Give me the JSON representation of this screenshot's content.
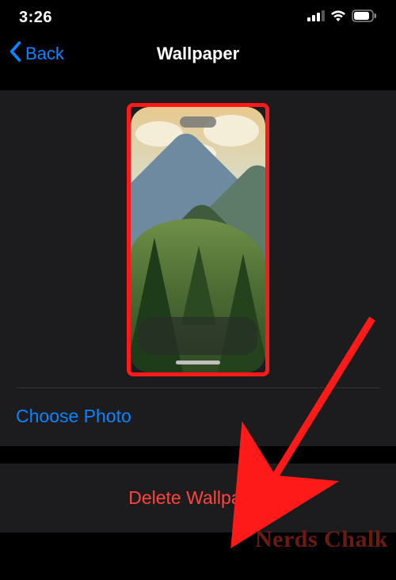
{
  "status": {
    "time": "3:26"
  },
  "nav": {
    "back_label": "Back",
    "title": "Wallpaper"
  },
  "preview": {
    "choose_photo_label": "Choose Photo"
  },
  "actions": {
    "delete_label": "Delete Wallpaper"
  },
  "watermark": "Nerds Chalk",
  "annotation": {
    "preview_highlight": true,
    "arrow_target": "delete"
  }
}
